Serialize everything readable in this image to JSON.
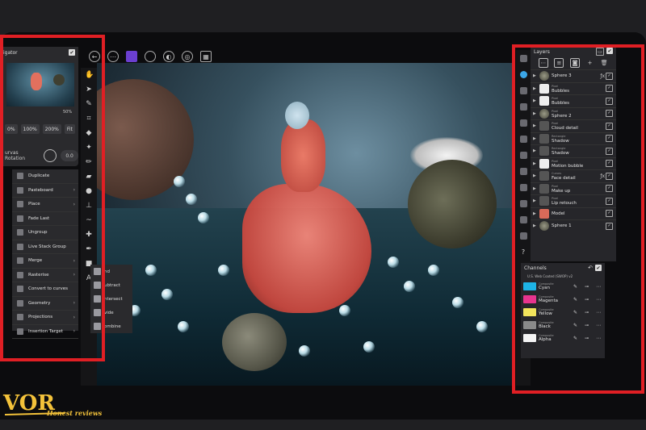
{
  "toolbar": {
    "icons": [
      "back-arrow-icon",
      "more-icon",
      "persona-icon",
      "circle-icon",
      "color-wheel-icon",
      "globe-icon",
      "grid-icon"
    ]
  },
  "navigator": {
    "title": "igator",
    "zoom_buttons": [
      "0%",
      "100%",
      "200%",
      "Fit"
    ],
    "zoom_percent": "50%",
    "rotation_label": "urvas Rotation",
    "rotation_value": "0.0"
  },
  "context_menu": {
    "items": [
      {
        "label": "Duplicate",
        "has_submenu": false
      },
      {
        "label": "Pasteboard",
        "has_submenu": true
      },
      {
        "label": "Place",
        "has_submenu": true
      },
      {
        "label": "Fade Last",
        "has_submenu": false
      },
      {
        "label": "Ungroup",
        "has_submenu": false
      },
      {
        "label": "Live Stack Group",
        "has_submenu": false
      },
      {
        "label": "Merge",
        "has_submenu": true
      },
      {
        "label": "Rasterise",
        "has_submenu": true
      },
      {
        "label": "Convert to curves",
        "has_submenu": false
      },
      {
        "label": "Geometry",
        "has_submenu": true
      },
      {
        "label": "Projections",
        "has_submenu": true
      },
      {
        "label": "Insertion Target",
        "has_submenu": true
      }
    ],
    "submenu": [
      "nd",
      "ubtract",
      "ntersect",
      "vide",
      "ombine"
    ]
  },
  "layers": {
    "title": "Layers",
    "rows": [
      {
        "type": "",
        "name": "Sphere 3",
        "thumb": "sph",
        "fx": true
      },
      {
        "type": "Pixel",
        "name": "Bubbles",
        "thumb": "white",
        "fx": false
      },
      {
        "type": "Pixel",
        "name": "Bubbles",
        "thumb": "white",
        "fx": false
      },
      {
        "type": "Pixel",
        "name": "Sphere 2",
        "thumb": "sph",
        "fx": false
      },
      {
        "type": "Pixel",
        "name": "Cloud detail",
        "thumb": "dark",
        "fx": false
      },
      {
        "type": "Rectangle",
        "name": "Shadow",
        "thumb": "dark",
        "fx": false
      },
      {
        "type": "Rectangle",
        "name": "Shadow",
        "thumb": "dark",
        "fx": false
      },
      {
        "type": "Pixel",
        "name": "Motion bubble",
        "thumb": "white",
        "fx": false
      },
      {
        "type": "Curves",
        "name": "Face detail",
        "thumb": "dark",
        "fx": true
      },
      {
        "type": "Pixel",
        "name": "Make up",
        "thumb": "dark",
        "fx": false
      },
      {
        "type": "Pixel",
        "name": "Lip retouch",
        "thumb": "dark",
        "fx": false
      },
      {
        "type": "",
        "name": "Model",
        "thumb": "red",
        "fx": false
      },
      {
        "type": "",
        "name": "Sphere 1",
        "thumb": "sph",
        "fx": false
      }
    ]
  },
  "channels": {
    "title": "Channels",
    "profile": "U.S. Web Coated (SWOP) v2",
    "rows": [
      {
        "type": "Composite",
        "name": "Cyan",
        "color": "#1eb4e6"
      },
      {
        "type": "Composite",
        "name": "Magenta",
        "color": "#e8348e"
      },
      {
        "type": "Composite",
        "name": "Yellow",
        "color": "#f2e45c"
      },
      {
        "type": "Composite",
        "name": "Black",
        "color": "#8a8a8a"
      },
      {
        "type": "Composite",
        "name": "Alpha",
        "color": "#f4f4f4"
      }
    ]
  },
  "watermark": {
    "logo_letters": "VOR",
    "text": "Honest reviews"
  },
  "colors": {
    "highlight": "#e01f24",
    "accent": "#6b3fd0",
    "brand_gold": "#f3c23a"
  }
}
